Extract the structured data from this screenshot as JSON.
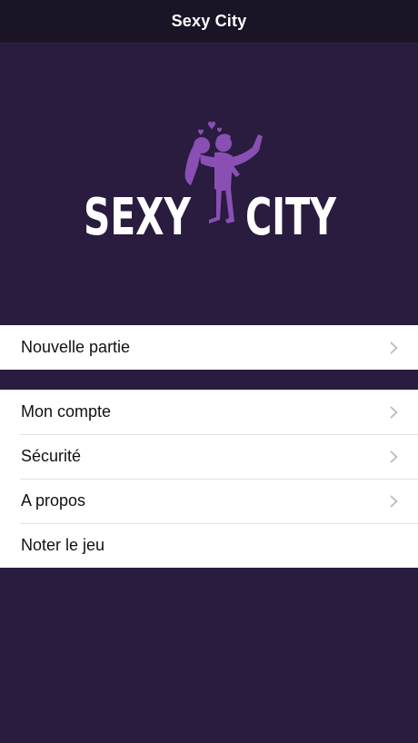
{
  "header": {
    "title": "Sexy City"
  },
  "logo": {
    "word_left": "SEXY",
    "word_right": "CITY",
    "accent_color": "#8a4fb5",
    "text_color": "#ffffff"
  },
  "menu_group_1": {
    "items": [
      {
        "label": "Nouvelle partie",
        "icon": "chevron-right-icon"
      }
    ]
  },
  "menu_group_2": {
    "items": [
      {
        "label": "Mon compte",
        "icon": "chevron-right-icon"
      },
      {
        "label": "Sécurité",
        "icon": "chevron-right-icon"
      },
      {
        "label": "A propos",
        "icon": "chevron-right-icon"
      },
      {
        "label": "Noter le jeu"
      }
    ]
  },
  "colors": {
    "background": "#291c3f",
    "navbar": "#1b1427",
    "accent": "#8a4fb5"
  }
}
